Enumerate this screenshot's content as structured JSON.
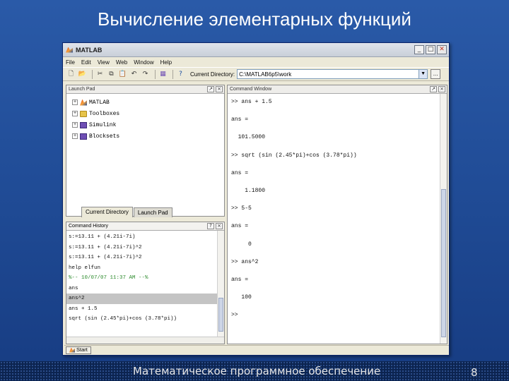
{
  "slide": {
    "title": "Вычисление элементарных функций",
    "footer": "Математическое программное обеспечение",
    "page_number": "8"
  },
  "window": {
    "title": "MATLAB",
    "controls": [
      "_",
      "□",
      "✕"
    ],
    "menu": [
      "File",
      "Edit",
      "View",
      "Web",
      "Window",
      "Help"
    ],
    "toolbar": {
      "buttons": [
        "new-icon",
        "open-icon",
        "cut-icon",
        "copy-icon",
        "paste-icon",
        "undo-icon",
        "redo-icon",
        "simulink-icon",
        "help-icon"
      ],
      "current_directory_label": "Current Directory:",
      "current_directory_value": "C:\\MATLAB6p5\\work",
      "browse_label": "..."
    }
  },
  "launch_pad": {
    "title": "Launch Pad",
    "items": [
      "MATLAB",
      "Toolboxes",
      "Simulink",
      "Blocksets"
    ],
    "tabs": [
      "Current Directory",
      "Launch Pad"
    ]
  },
  "command_history": {
    "title": "Command History",
    "lines": [
      "s:=13.11 + (4.21i-7i)",
      "s:=13.11 + (4.21i-7i)^2",
      "s:=13.11 + (4.21i-7i)^2",
      "help elfun",
      "%-- 10/07/07 11:37 AM --%",
      "ans",
      "ans^2",
      "ans + 1.5",
      "sqrt (sin (2.45*pi)+cos (3.78*pi))"
    ]
  },
  "command_window": {
    "title": "Command Window",
    "lines": [
      ">> ans + 1.5",
      "",
      "ans =",
      "",
      "  101.5000",
      "",
      ">> sqrt (sin (2.45*pi)+cos (3.78*pi))",
      "",
      "ans =",
      "",
      "    1.1800",
      "",
      ">> 5-5",
      "",
      "ans =",
      "",
      "     0",
      "",
      ">> ans^2",
      "",
      "ans =",
      "",
      "   100",
      "",
      ">>"
    ]
  },
  "statusbar": {
    "start_label": "Start"
  }
}
